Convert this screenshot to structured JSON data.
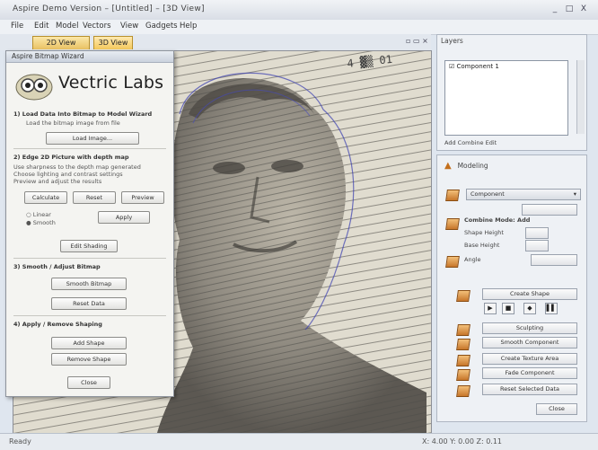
{
  "window": {
    "title": "Aspire Demo Version – [Untitled] – [3D View]",
    "minimize": "_",
    "maximize": "□",
    "close": "X"
  },
  "menu": [
    "File",
    "Edit",
    "Model",
    "Vectors",
    "View",
    "Gadgets",
    "Help"
  ],
  "tabs": [
    {
      "label": "2D View"
    },
    {
      "label": "3D View"
    }
  ],
  "wizard": {
    "title": "Aspire Bitmap Wizard",
    "logo": "Vectric Labs",
    "sections": [
      {
        "heading": "1) Load Data Into Bitmap to Model Wizard",
        "line": "Load the bitmap image from file",
        "button": "Load Image..."
      },
      {
        "heading": "2) Edge 2D Picture with depth map",
        "lines": [
          "Use sharpness to the depth map generated",
          "Choose lighting and contrast settings",
          "Preview and adjust the results"
        ],
        "buttons": [
          "Calculate",
          "Reset",
          "Preview"
        ],
        "options": [
          "Linear",
          "Smooth"
        ],
        "option_button": "Apply",
        "extra_button": "Edit Shading"
      },
      {
        "heading": "3) Smooth / Adjust Bitmap",
        "buttons": [
          "Smooth Bitmap",
          "Reset Data"
        ]
      },
      {
        "heading": "4) Apply / Remove Shaping",
        "buttons": [
          "Add Shape",
          "Remove Shape"
        ]
      }
    ],
    "close_button": "Close"
  },
  "right_panel": {
    "title": "Layers",
    "list_item": "Component 1",
    "tool_row": "Add  Combine  Edit",
    "section_title": "Modeling",
    "dropdown": "Component",
    "sub_label": "Combine Mode: Add",
    "fields": [
      "Shape Height",
      "Base Height",
      "Angle"
    ],
    "buttons": [
      "Create Shape",
      "Sculpting",
      "Smooth Component",
      "Create Texture Area",
      "Fade Component",
      "Reset Selected Data"
    ],
    "tool_icons": [
      "▶",
      "■",
      "◆",
      "▌▌"
    ],
    "bottom_button": "Close"
  },
  "status": {
    "left": "Ready",
    "right": "X: 4.00  Y: 0.00  Z: 0.11"
  }
}
